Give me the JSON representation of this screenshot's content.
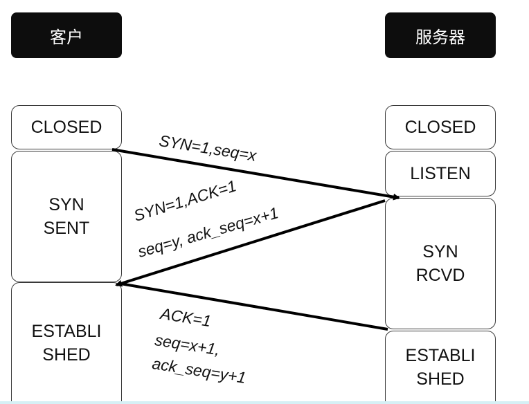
{
  "client": {
    "header": "客户",
    "states": {
      "closed": "CLOSED",
      "syn_sent": [
        "SYN",
        "SENT"
      ],
      "established": [
        "ESTABLI",
        "SHED"
      ]
    }
  },
  "server": {
    "header": "服务器",
    "states": {
      "closed": "CLOSED",
      "listen": "LISTEN",
      "syn_rcvd": [
        "SYN",
        "RCVD"
      ],
      "established": [
        "ESTABLI",
        "SHED"
      ]
    }
  },
  "messages": {
    "syn": [
      "SYN=1,seq=x"
    ],
    "syn_ack": [
      "SYN=1,ACK=1",
      "seq=y, ack_seq=x+1"
    ],
    "ack": [
      "ACK=1",
      "seq=x+1,",
      "ack_seq=y+1"
    ]
  }
}
